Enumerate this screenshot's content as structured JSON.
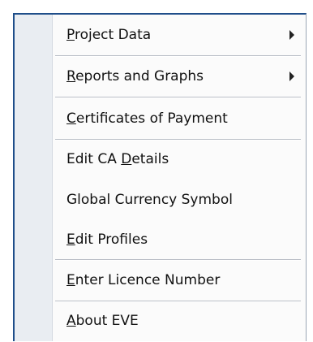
{
  "menu": {
    "items": [
      {
        "pre": "",
        "key": "P",
        "post": "roject Data",
        "submenu_icon": "chevron-right-icon"
      },
      {
        "pre": "",
        "key": "R",
        "post": "eports and Graphs",
        "submenu_icon": "chevron-right-icon"
      },
      {
        "pre": "",
        "key": "C",
        "post": "ertificates of Payment"
      },
      {
        "pre": "Edit CA ",
        "key": "D",
        "post": "etails"
      },
      {
        "pre": "Global Currency Symbol",
        "key": "",
        "post": ""
      },
      {
        "pre": "",
        "key": "E",
        "post": "dit Profiles"
      },
      {
        "pre": "",
        "key": "E",
        "post": "nter Licence Number"
      },
      {
        "pre": "",
        "key": "A",
        "post": "bout EVE"
      }
    ]
  }
}
